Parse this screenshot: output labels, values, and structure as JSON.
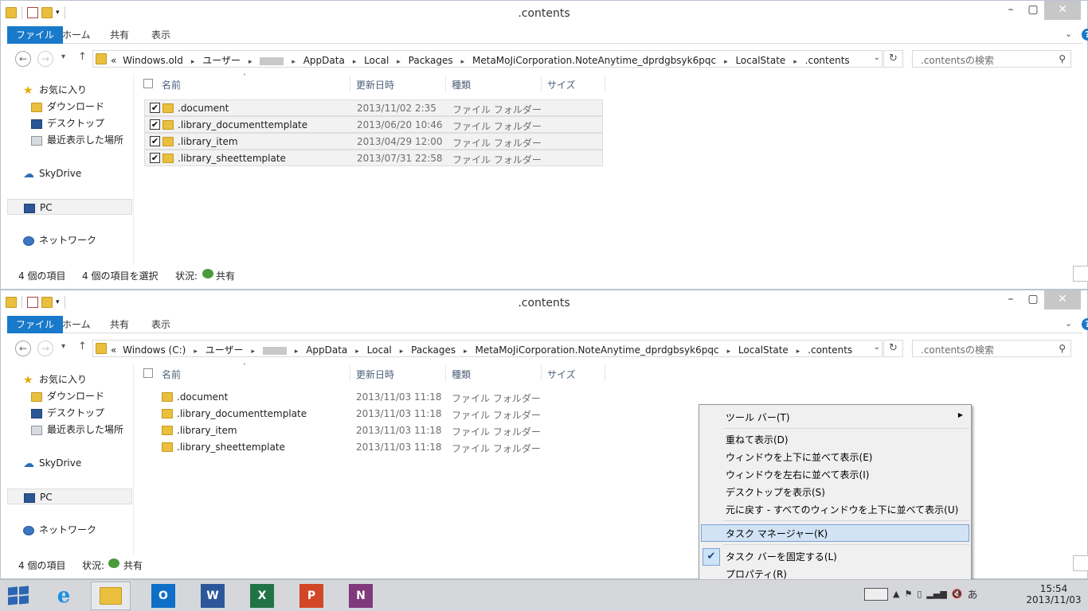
{
  "window_top": {
    "title": ".contents",
    "tabs": [
      "ファイル",
      "ホーム",
      "共有",
      "表示"
    ],
    "address": {
      "crumbs": [
        "Windows.old",
        "ユーザー",
        "AppData",
        "Local",
        "Packages",
        "MetaMoJiCorporation.NoteAnytime_dprdgbsyk6pqc",
        "LocalState",
        ".contents"
      ]
    },
    "search_placeholder": ".contentsの検索",
    "nav": {
      "favorites": "お気に入り",
      "downloads": "ダウンロード",
      "desktop": "デスクトップ",
      "recent": "最近表示した場所",
      "skydrive": "SkyDrive",
      "pc": "PC",
      "network": "ネットワーク"
    },
    "columns": {
      "name": "名前",
      "date": "更新日時",
      "type": "種類",
      "size": "サイズ"
    },
    "rows": [
      {
        "name": ".document",
        "date": "2013/11/02 2:35",
        "type": "ファイル フォルダー"
      },
      {
        "name": ".library_documenttemplate",
        "date": "2013/06/20 10:46",
        "type": "ファイル フォルダー"
      },
      {
        "name": ".library_item",
        "date": "2013/04/29 12:00",
        "type": "ファイル フォルダー"
      },
      {
        "name": ".library_sheettemplate",
        "date": "2013/07/31 22:58",
        "type": "ファイル フォルダー"
      }
    ],
    "status": {
      "count": "4 個の項目",
      "selected": "4 個の項目を選択",
      "state_label": "状況:",
      "state_value": "共有"
    }
  },
  "window_bottom": {
    "title": ".contents",
    "tabs": [
      "ファイル",
      "ホーム",
      "共有",
      "表示"
    ],
    "address": {
      "crumbs": [
        "Windows (C:)",
        "ユーザー",
        "AppData",
        "Local",
        "Packages",
        "MetaMoJiCorporation.NoteAnytime_dprdgbsyk6pqc",
        "LocalState",
        ".contents"
      ]
    },
    "search_placeholder": ".contentsの検索",
    "nav": {
      "favorites": "お気に入り",
      "downloads": "ダウンロード",
      "desktop": "デスクトップ",
      "recent": "最近表示した場所",
      "skydrive": "SkyDrive",
      "pc": "PC",
      "network": "ネットワーク"
    },
    "columns": {
      "name": "名前",
      "date": "更新日時",
      "type": "種類",
      "size": "サイズ"
    },
    "rows": [
      {
        "name": ".document",
        "date": "2013/11/03 11:18",
        "type": "ファイル フォルダー"
      },
      {
        "name": ".library_documenttemplate",
        "date": "2013/11/03 11:18",
        "type": "ファイル フォルダー"
      },
      {
        "name": ".library_item",
        "date": "2013/11/03 11:18",
        "type": "ファイル フォルダー"
      },
      {
        "name": ".library_sheettemplate",
        "date": "2013/11/03 11:18",
        "type": "ファイル フォルダー"
      }
    ],
    "status": {
      "count": "4 個の項目",
      "state_label": "状況:",
      "state_value": "共有"
    }
  },
  "context_menu": {
    "items": [
      "ツール バー(T)",
      "重ねて表示(D)",
      "ウィンドウを上下に並べて表示(E)",
      "ウィンドウを左右に並べて表示(I)",
      "デスクトップを表示(S)",
      "元に戻す - すべてのウィンドウを上下に並べて表示(U)",
      "タスク マネージャー(K)",
      "タスク バーを固定する(L)",
      "プロパティ(R)"
    ]
  },
  "taskbar": {
    "apps": [
      {
        "icon": "outlook-icon",
        "letter": "O",
        "color": "#0f6fc6"
      },
      {
        "icon": "word-icon",
        "letter": "W",
        "color": "#2b579a"
      },
      {
        "icon": "excel-icon",
        "letter": "X",
        "color": "#217346"
      },
      {
        "icon": "powerpoint-icon",
        "letter": "P",
        "color": "#d24726"
      },
      {
        "icon": "onenote-icon",
        "letter": "N",
        "color": "#80397b"
      }
    ],
    "ime": "あ",
    "time": "15:54",
    "date": "2013/11/03"
  }
}
